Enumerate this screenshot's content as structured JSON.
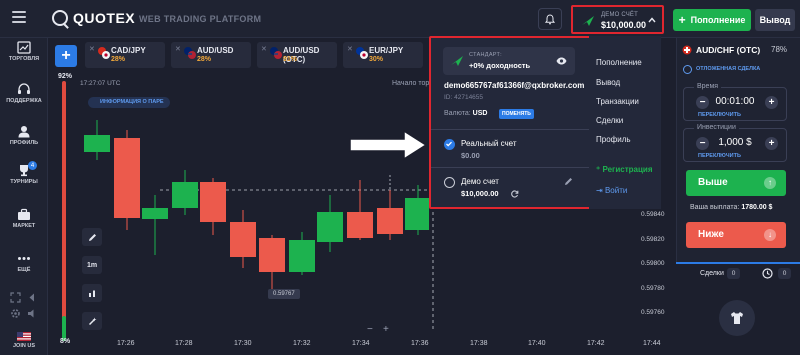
{
  "header": {
    "brand": "QUOTEX",
    "platform_tag": "WEB TRADING PLATFORM",
    "account_mode": "ДЕМО СЧЁТ",
    "account_balance": "$10,000.00",
    "deposit_label": "Пополнение",
    "withdraw_label": "Вывод"
  },
  "sidebar": {
    "items": [
      {
        "label": "ТОРГОВЛЯ",
        "icon": "chart-icon"
      },
      {
        "label": "ПОДДЕРЖКА",
        "icon": "support-icon"
      },
      {
        "label": "ПРОФИЛЬ",
        "icon": "profile-icon"
      },
      {
        "label": "ТУРНИРЫ",
        "icon": "trophy-icon",
        "badge": "4"
      },
      {
        "label": "МАРКЕТ",
        "icon": "market-icon"
      },
      {
        "label": "ЕЩЁ",
        "icon": "more-icon"
      }
    ],
    "join_label": "JOIN US"
  },
  "asset_tabs": [
    {
      "name": "CAD/JPY",
      "pct": "28%"
    },
    {
      "name": "AUD/USD",
      "pct": "28%"
    },
    {
      "name": "AUD/USD (OTC)",
      "pct": "91%"
    },
    {
      "name": "EUR/JPY",
      "pct": "30%"
    }
  ],
  "chart": {
    "top_pct": "92%",
    "bottom_pct": "8%",
    "clock": "17:27:07 UTC",
    "info_pill": "ИНФОРМАЦИЯ О ПАРЕ",
    "start_label": "Начало тор",
    "timeframe": "1m",
    "price_marker": "0.59767",
    "y_labels": [
      "0.59840",
      "0.59820",
      "0.59800",
      "0.59780",
      "0.59760"
    ],
    "x_labels": [
      "17:26",
      "17:28",
      "17:30",
      "17:32",
      "17:34",
      "17:36",
      "17:38",
      "17:40",
      "17:42",
      "17:44"
    ],
    "zoom_minus": "−",
    "zoom_plus": "+"
  },
  "dropdown": {
    "strategy_level": "СТАНДАРТ:",
    "strategy_yield": "+0% доходность",
    "email": "demo665767af61366f@qxbroker.com",
    "account_id": "ID: 42714655",
    "currency_label": "Валюта:",
    "currency_value": "USD",
    "change_label": "ПОМЕНЯТЬ",
    "real_account": "Реальный счет",
    "real_balance": "$0.00",
    "demo_account": "Демо счет",
    "demo_balance": "$10,000.00",
    "menu": [
      "Пополнение",
      "Вывод",
      "Транзакции",
      "Сделки",
      "Профиль"
    ],
    "register_label": "Регистрация",
    "login_label": "Войти"
  },
  "trade_panel": {
    "pair": "AUD/CHF (OTC)",
    "pair_pct": "78%",
    "pending_label": "ОТЛОЖЕННАЯ СДЕЛКА",
    "time_label": "Время",
    "time_value": "00:01:00",
    "switch_label": "ПЕРЕКЛЮЧИТЬ",
    "investment_label": "Инвестиции",
    "investment_value": "1,000 $",
    "up_label": "Выше",
    "payout_label": "Ваша выплата:",
    "payout_value": "1780.00 $",
    "down_label": "Ниже",
    "trades_label": "Сделки",
    "trades_count": "0",
    "pending_count": "0"
  },
  "colors": {
    "up": "#1db24f",
    "down": "#ec5a4c",
    "accent": "#2c7be5",
    "highlight": "#e0262f"
  }
}
